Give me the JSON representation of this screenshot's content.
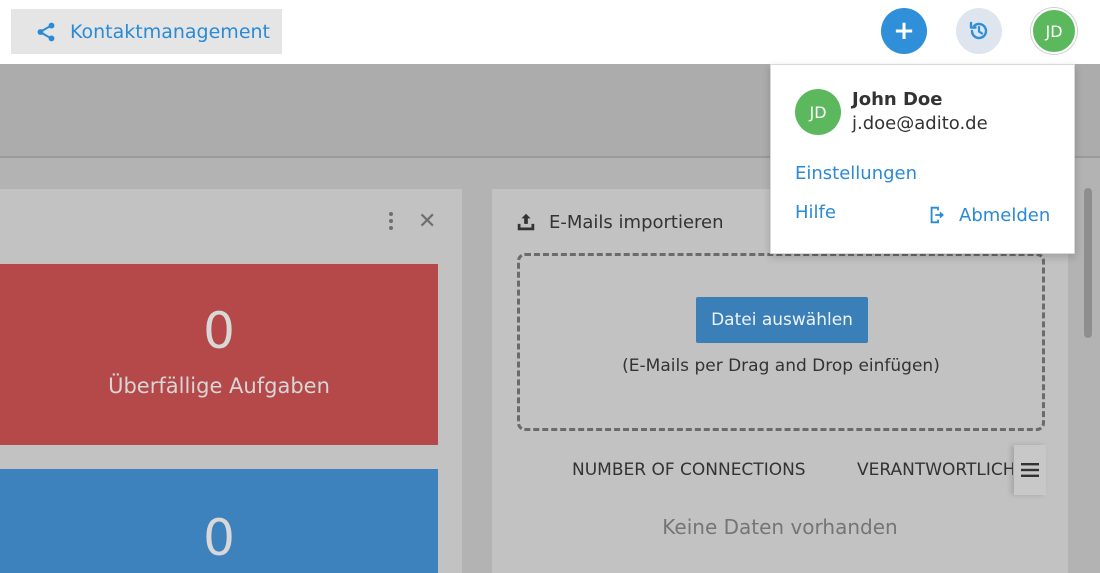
{
  "topbar": {
    "app_title": "Kontaktmanagement",
    "add_label": "+",
    "avatar_initials": "JD"
  },
  "left_panel": {
    "tiles": [
      {
        "value": "0",
        "label": "Überfällige Aufgaben",
        "color": "#b54848"
      },
      {
        "value": "0",
        "label": "",
        "color": "#3d82bd"
      }
    ]
  },
  "right_panel": {
    "title": "E-Mails importieren",
    "choose_button": "Datei auswählen",
    "drop_hint": "(E-Mails per Drag and Drop einfügen)",
    "columns": [
      "NUMBER OF CONNECTIONS",
      "VERANTWORTLICH"
    ],
    "empty_text": "Keine Daten vorhanden"
  },
  "user_menu": {
    "initials": "JD",
    "name": "John Doe",
    "email": "j.doe@adito.de",
    "settings": "Einstellungen",
    "help": "Hilfe",
    "logout": "Abmelden"
  },
  "colors": {
    "accent": "#2a8ad6",
    "avatar": "#5cb85c"
  }
}
